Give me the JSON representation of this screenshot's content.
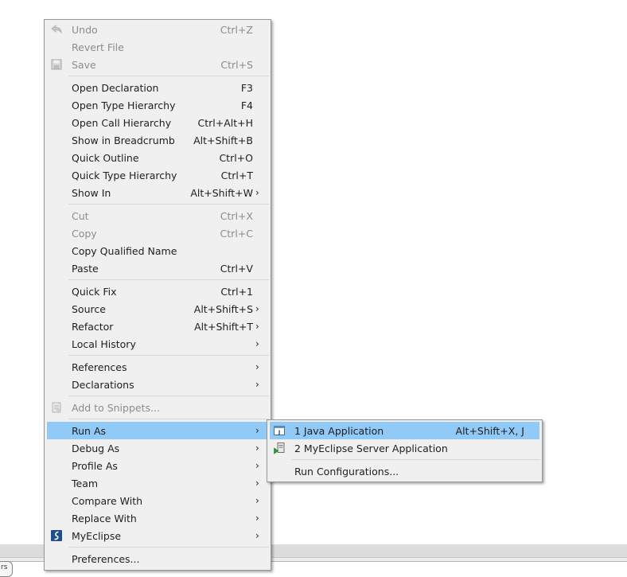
{
  "context_menu": {
    "undo": {
      "label": "Undo",
      "shortcut": "Ctrl+Z"
    },
    "revert_file": {
      "label": "Revert File"
    },
    "save": {
      "label": "Save",
      "shortcut": "Ctrl+S"
    },
    "open_declaration": {
      "label": "Open Declaration",
      "shortcut": "F3"
    },
    "open_type_hierarchy": {
      "label": "Open Type Hierarchy",
      "shortcut": "F4"
    },
    "open_call_hierarchy": {
      "label": "Open Call Hierarchy",
      "shortcut": "Ctrl+Alt+H"
    },
    "show_in_breadcrumb": {
      "label": "Show in Breadcrumb",
      "shortcut": "Alt+Shift+B"
    },
    "quick_outline": {
      "label": "Quick Outline",
      "shortcut": "Ctrl+O"
    },
    "quick_type_hierarchy": {
      "label": "Quick Type Hierarchy",
      "shortcut": "Ctrl+T"
    },
    "show_in": {
      "label": "Show In",
      "shortcut": "Alt+Shift+W"
    },
    "cut": {
      "label": "Cut",
      "shortcut": "Ctrl+X"
    },
    "copy": {
      "label": "Copy",
      "shortcut": "Ctrl+C"
    },
    "copy_qualified_name": {
      "label": "Copy Qualified Name"
    },
    "paste": {
      "label": "Paste",
      "shortcut": "Ctrl+V"
    },
    "quick_fix": {
      "label": "Quick Fix",
      "shortcut": "Ctrl+1"
    },
    "source": {
      "label": "Source",
      "shortcut": "Alt+Shift+S"
    },
    "refactor": {
      "label": "Refactor",
      "shortcut": "Alt+Shift+T"
    },
    "local_history": {
      "label": "Local History"
    },
    "references": {
      "label": "References"
    },
    "declarations": {
      "label": "Declarations"
    },
    "add_to_snippets": {
      "label": "Add to Snippets..."
    },
    "run_as": {
      "label": "Run As"
    },
    "debug_as": {
      "label": "Debug As"
    },
    "profile_as": {
      "label": "Profile As"
    },
    "team": {
      "label": "Team"
    },
    "compare_with": {
      "label": "Compare With"
    },
    "replace_with": {
      "label": "Replace With"
    },
    "myeclipse": {
      "label": "MyEclipse"
    },
    "preferences": {
      "label": "Preferences..."
    }
  },
  "run_as_submenu": {
    "java_application": {
      "label": "1 Java Application",
      "shortcut": "Alt+Shift+X, J"
    },
    "myeclipse_server_application": {
      "label": "2 MyEclipse Server Application"
    },
    "run_configurations": {
      "label": "Run Configurations..."
    }
  },
  "background": {
    "tab_text": "rs"
  },
  "colors": {
    "highlight": "#91c9f7",
    "menu_bg": "#f0f0f0",
    "disabled_text": "#8c8c8c"
  }
}
